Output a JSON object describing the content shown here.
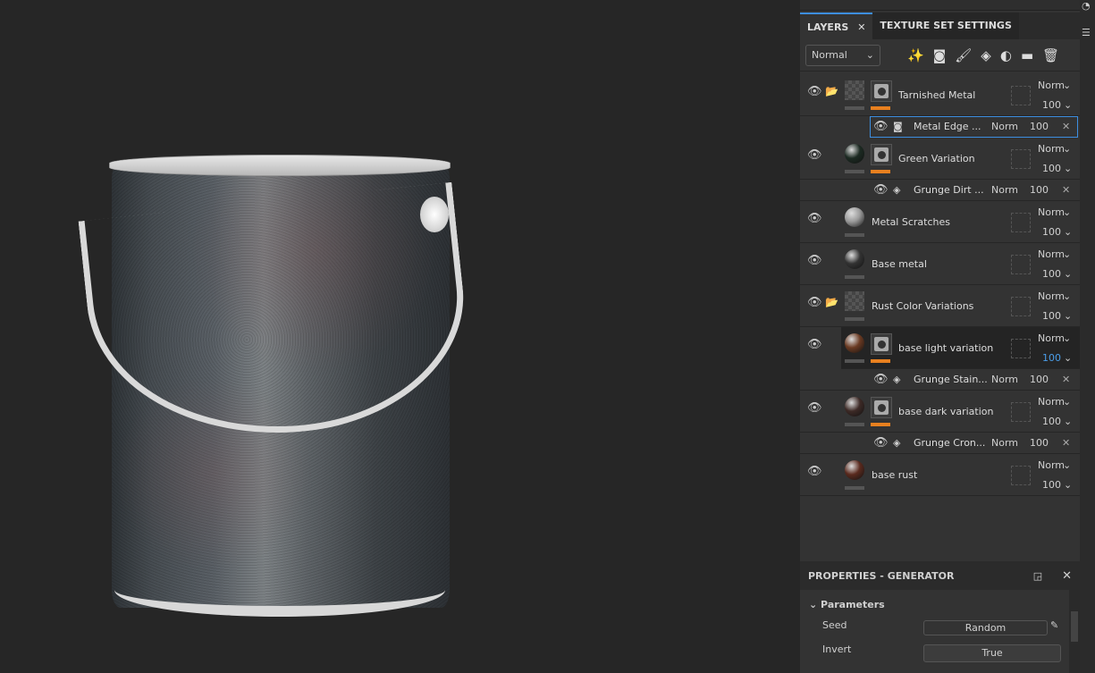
{
  "layers_panel": {
    "tab_layers": "LAYERS",
    "tab_close": "✕",
    "tab_texture_set": "TEXTURE SET SETTINGS",
    "blend_mode": "Normal",
    "tools": [
      {
        "icon": "magic-wand-icon",
        "glyph": "✨"
      },
      {
        "icon": "add-mask-icon",
        "glyph": "◙"
      },
      {
        "icon": "paint-layer-icon",
        "glyph": "🖌"
      },
      {
        "icon": "fill-layer-icon",
        "glyph": "◈"
      },
      {
        "icon": "add-effect-icon",
        "glyph": "◐"
      },
      {
        "icon": "folder-icon",
        "glyph": "▬"
      },
      {
        "icon": "delete-icon",
        "glyph": "🗑"
      }
    ],
    "layers": [
      {
        "type": "main",
        "name": "Tarnished Metal",
        "folder": true,
        "thumb": "check",
        "mask": true,
        "blend": "Norm",
        "opacity": "100"
      },
      {
        "type": "sub",
        "name": "Metal Edge ...",
        "icon": "generator",
        "blend": "Norm",
        "opacity": "100",
        "selected": true
      },
      {
        "type": "main",
        "name": "Green Variation",
        "thumb": "#1c2a22",
        "mask": true,
        "blend": "Norm",
        "opacity": "100"
      },
      {
        "type": "sub",
        "name": "Grunge Dirt ...",
        "icon": "fill",
        "blend": "Norm",
        "opacity": "100"
      },
      {
        "type": "main",
        "name": "Metal Scratches",
        "thumb": "#9a9a9a",
        "blend": "Norm",
        "opacity": "100"
      },
      {
        "type": "main",
        "name": "Base metal",
        "thumb": "#333",
        "blend": "Norm",
        "opacity": "100"
      },
      {
        "type": "main",
        "name": "Rust Color Variations",
        "folder": true,
        "thumb": "check",
        "blend": "Norm",
        "opacity": "100"
      },
      {
        "type": "main",
        "name": "base light variation",
        "thumb": "#6a3a22",
        "mask": true,
        "blend": "Norm",
        "opacity": "100",
        "active": true
      },
      {
        "type": "sub",
        "name": "Grunge Stain...",
        "icon": "fill",
        "blend": "Norm",
        "opacity": "100"
      },
      {
        "type": "main",
        "name": "base dark variation",
        "thumb": "#3d2a26",
        "mask": true,
        "blend": "Norm",
        "opacity": "100"
      },
      {
        "type": "sub",
        "name": "Grunge Cron...",
        "icon": "fill",
        "blend": "Norm",
        "opacity": "100"
      },
      {
        "type": "main",
        "name": "base rust",
        "thumb": "#5a2a1e",
        "blend": "Norm",
        "opacity": "100"
      }
    ]
  },
  "properties": {
    "title": "PROPERTIES - GENERATOR",
    "section": "Parameters",
    "seed_label": "Seed",
    "seed_value": "Random",
    "invert_label": "Invert",
    "invert_value": "True"
  },
  "colors": {
    "accent": "#3d8ee0",
    "orange": "#e8801f"
  }
}
